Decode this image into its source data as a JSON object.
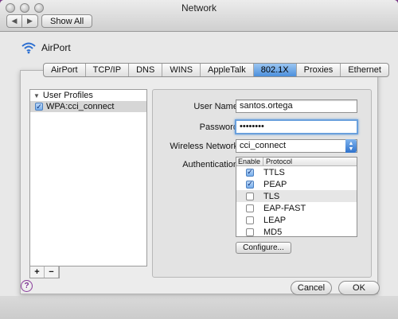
{
  "window": {
    "title": "Network"
  },
  "toolbar": {
    "back": "◀",
    "forward": "▶",
    "show_all": "Show All"
  },
  "airport": {
    "name": "AirPort"
  },
  "tabs": [
    {
      "label": "AirPort"
    },
    {
      "label": "TCP/IP"
    },
    {
      "label": "DNS"
    },
    {
      "label": "WINS"
    },
    {
      "label": "AppleTalk"
    },
    {
      "label": "802.1X",
      "active": true
    },
    {
      "label": "Proxies"
    },
    {
      "label": "Ethernet"
    }
  ],
  "profiles": {
    "header": "User Profiles",
    "items": [
      {
        "label": "WPA:cci_connect",
        "checked": true
      }
    ],
    "add": "+",
    "remove": "−"
  },
  "form": {
    "user_name_label": "User Name:",
    "user_name_value": "santos.ortega",
    "password_label": "Password:",
    "password_value": "••••••••",
    "network_label": "Wireless Network:",
    "network_value": "cci_connect",
    "auth_label": "Authentication:",
    "auth_col_enable": "Enable",
    "auth_col_protocol": "Protocol",
    "protocols": [
      {
        "name": "TTLS",
        "enabled": true
      },
      {
        "name": "PEAP",
        "enabled": true
      },
      {
        "name": "TLS",
        "enabled": false
      },
      {
        "name": "EAP-FAST",
        "enabled": false
      },
      {
        "name": "LEAP",
        "enabled": false
      },
      {
        "name": "MD5",
        "enabled": false
      }
    ],
    "configure_label": "Configure..."
  },
  "footer": {
    "help": "?",
    "cancel": "Cancel",
    "ok": "OK"
  },
  "colors": {
    "accent": "#4b8fdc",
    "focus_ring": "#6aa0dc",
    "desktop": "#6a3079"
  }
}
